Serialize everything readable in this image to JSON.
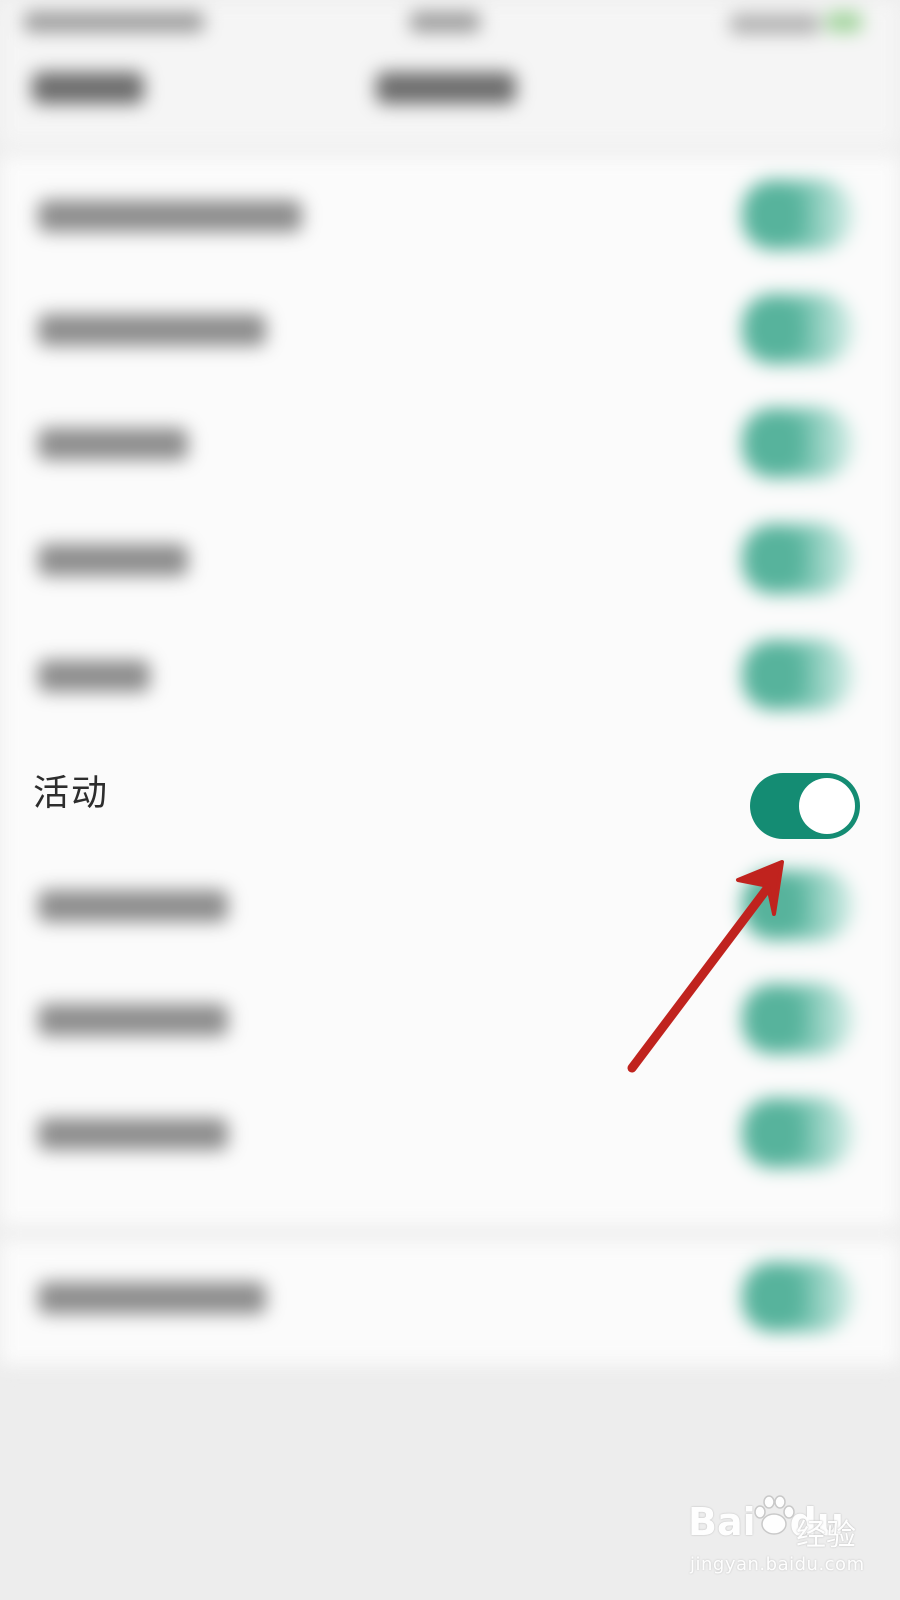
{
  "settings_row": {
    "label": "活动",
    "toggle_on": true
  },
  "colors": {
    "toggle_on": "#148c73",
    "annotation_arrow": "#c0231e",
    "background": "#ededed",
    "card": "#fbfbfb"
  },
  "watermark": {
    "brand": "Bai",
    "brand_end": "du",
    "cn": "经验",
    "url": "jingyan.baidu.com"
  }
}
